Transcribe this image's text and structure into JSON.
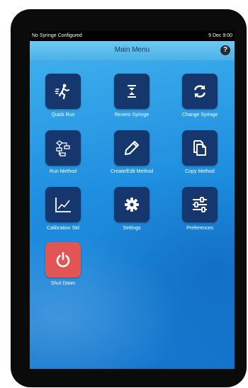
{
  "status_bar": {
    "left_text": "No Syringe Configured",
    "right_text": "9 Dec 9:00"
  },
  "header": {
    "title": "Main Menu",
    "help_label": "?"
  },
  "menu": {
    "quick_run": "Quick Run",
    "rezero_syringe": "Rezero Syringe",
    "change_syringe": "Change Syringe",
    "run_method": "Run Method",
    "create_edit_method": "Create/Edit Method",
    "copy_method": "Copy Method",
    "calibration_std": "Calibration Std",
    "settings": "Settings",
    "preferences": "Preferences",
    "shut_down": "Shut Down"
  },
  "colors": {
    "tile": "#16376d",
    "shutdown_tile": "#e25555",
    "background": "#1f8fe0"
  }
}
